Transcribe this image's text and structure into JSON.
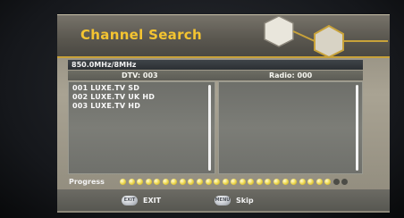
{
  "title": "Channel Search",
  "frequency": "850.0MHz/8MHz",
  "dtv_count_label": "DTV: 003",
  "radio_count_label": "Radio: 000",
  "tv_channels": [
    "001 LUXE.TV SD",
    "002 LUXE.TV UK HD",
    "003 LUXE.TV HD"
  ],
  "radio_channels": [],
  "progress": {
    "label": "Progress",
    "fraction": 0.93,
    "total_dots": 27
  },
  "footer": {
    "exit_label": "EXIT",
    "exit_key": "EXIT",
    "skip_label": "Skip",
    "skip_key": "MENU"
  },
  "colors": {
    "title": "#f4c431",
    "progress_dot": "#f1dd59",
    "accent_line": "#c8a23a"
  }
}
